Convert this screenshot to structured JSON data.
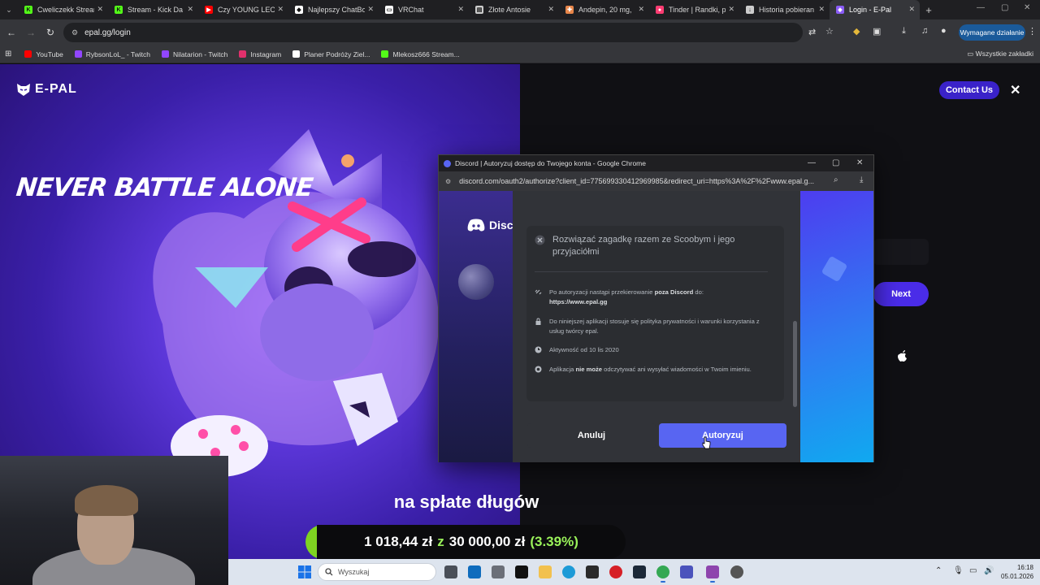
{
  "browser": {
    "tabs": [
      {
        "label": "Cweliczekk Stream",
        "color": "#53fc18",
        "glyph": "K"
      },
      {
        "label": "Stream - Kick Da",
        "color": "#53fc18",
        "glyph": "K"
      },
      {
        "label": "Czy YOUNG LEOS",
        "color": "#ff0000",
        "glyph": "▶"
      },
      {
        "label": "Najlepszy ChatBo",
        "color": "#ffffff",
        "glyph": "◆"
      },
      {
        "label": "VRChat",
        "color": "#ffffff",
        "glyph": "▭"
      },
      {
        "label": "Złote Antosie",
        "color": "#cccccc",
        "glyph": "▤"
      },
      {
        "label": "Andepin, 20 mg,",
        "color": "#e8864a",
        "glyph": "✚"
      },
      {
        "label": "Tinder | Randki, p",
        "color": "#fe3c72",
        "glyph": "●"
      },
      {
        "label": "Historia pobieran",
        "color": "#cccccc",
        "glyph": "↓"
      },
      {
        "label": "Login - E-Pal",
        "color": "#8a5cf6",
        "glyph": "◈"
      }
    ],
    "url": "epal.gg/login",
    "action_pill": "Wymagane działanie",
    "bookmarks": [
      {
        "label": "YouTube",
        "color": "#ff0000"
      },
      {
        "label": "RybsonLoL_ - Twitch",
        "color": "#9146ff"
      },
      {
        "label": "Nilatarion - Twitch",
        "color": "#9146ff"
      },
      {
        "label": "Instagram",
        "color": "#e1306c"
      },
      {
        "label": "Planer Podróży Ziel...",
        "color": "#ffffff"
      },
      {
        "label": "Mlekosz666 Stream...",
        "color": "#53fc18"
      }
    ],
    "bookmarks_all": "Wszystkie zakładki"
  },
  "page": {
    "logo": "E-PAL",
    "slogan": "NEVER BATTLE ALONE",
    "contact": "Contact Us",
    "next": "Next",
    "accent": "#4a2ce8"
  },
  "popup": {
    "title": "Discord | Autoryzuj dostęp do Twojego konta - Google Chrome",
    "url": "discord.com/oauth2/authorize?client_id=775699330412969985&redirect_uri=https%3A%2F%2Fwww.epal.g...",
    "discord_word": "Disc",
    "scope": "Rozwiązać zagadkę razem ze Scoobym i jego przyjaciółmi",
    "info": [
      {
        "pre": "Po autoryzacji nastąpi przekierowanie ",
        "bold": "poza Discord",
        "post": " do:",
        "line2": "https://www.epal.gg"
      },
      {
        "pre": "Do niniejszej aplikacji stosuje się polityka prywatności i warunki korzystania z usług twórcy epal.",
        "bold": "",
        "post": "",
        "line2": ""
      },
      {
        "pre": "Aktywność od 10 lis 2020",
        "bold": "",
        "post": "",
        "line2": ""
      },
      {
        "pre": "Aplikacja ",
        "bold": "nie może",
        "post": " odczytywać ani wysyłać wiadomości w Twoim imieniu.",
        "line2": ""
      }
    ],
    "cancel": "Anuluj",
    "authorize": "Autoryzuj",
    "accent": "#5865f2"
  },
  "overlay": {
    "goal_title": "na spłate długów",
    "current": "1 018,44 zł",
    "z": "z",
    "target": "30 000,00 zł",
    "percent": "(3.39%)",
    "progress_fraction": 0.0339
  },
  "taskbar": {
    "search": "Wyszukaj",
    "time": "16:18",
    "date": "05.01.2026"
  }
}
